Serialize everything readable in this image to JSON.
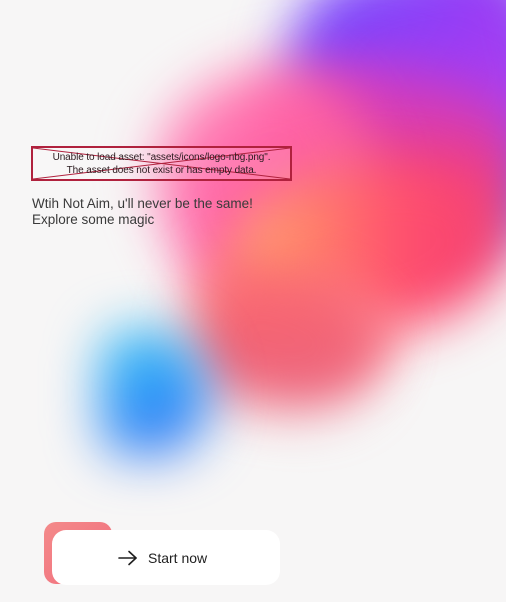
{
  "error_placeholder": {
    "line1": "Unable to load asset: \"assets/icons/logo-nbg.png\".",
    "line2": "The asset does not exist or has empty data.",
    "border_color": "#b0213d"
  },
  "tagline": {
    "line1": "Wtih Not Aim, u'll never be the same!",
    "line2": "Explore some magic"
  },
  "start_button": {
    "label": "Start now",
    "icon": "arrow-right-icon",
    "accent_color": "#f26c7c"
  },
  "background_colors": [
    "#6a4cff",
    "#9a3cf5",
    "#ff5ea3",
    "#ff4f6e",
    "#ffb57a",
    "#33c8f3",
    "#2f8ef8"
  ]
}
